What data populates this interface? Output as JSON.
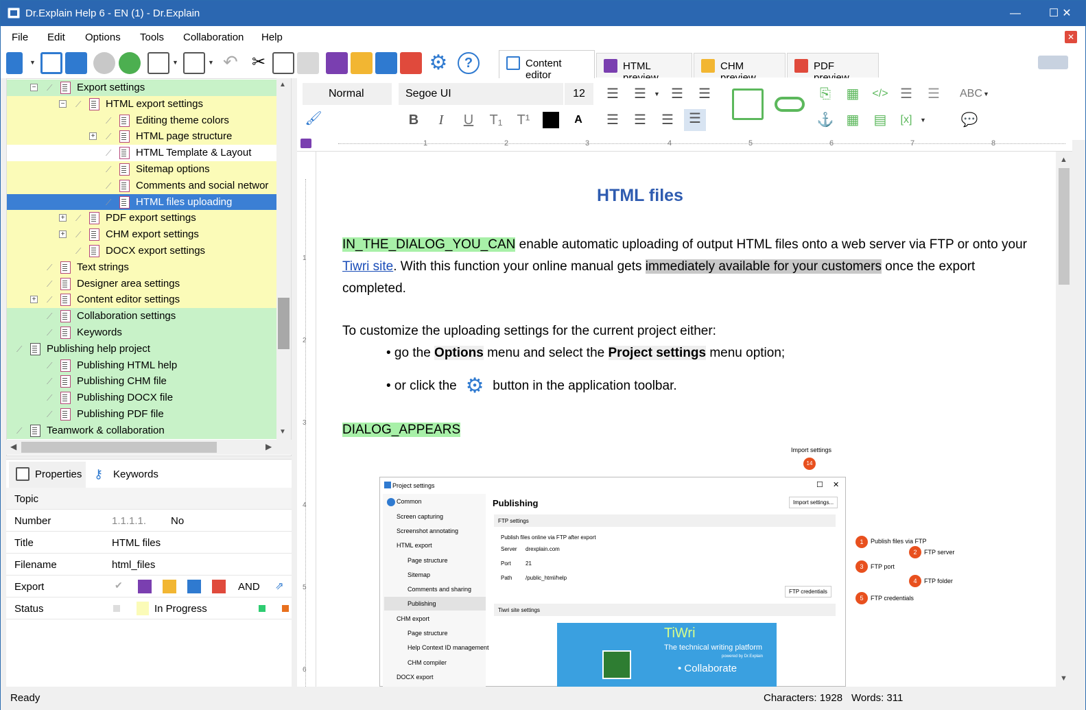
{
  "window": {
    "title": "Dr.Explain Help 6 - EN (1) - Dr.Explain",
    "minimize": "—",
    "maximize": "☐",
    "close": "✕"
  },
  "menu": [
    "File",
    "Edit",
    "Options",
    "Tools",
    "Collaboration",
    "Help"
  ],
  "tabs": {
    "content_editor": "Content editor",
    "html_preview": "HTML preview",
    "chm_preview": "CHM preview",
    "pdf_preview": "PDF preview"
  },
  "tree": [
    {
      "label": "Export settings",
      "level": 2,
      "color": "g",
      "expander": "−",
      "icon": "doc"
    },
    {
      "label": "HTML export settings",
      "level": 3,
      "color": "y",
      "expander": "−",
      "icon": "doc"
    },
    {
      "label": "Editing theme colors",
      "level": 4,
      "color": "y",
      "expander": "",
      "icon": "doc"
    },
    {
      "label": "HTML page structure",
      "level": 4,
      "color": "y",
      "expander": "+",
      "icon": "doc"
    },
    {
      "label": "HTML Template &  Layout",
      "level": 4,
      "color": "w",
      "expander": "",
      "icon": "doc"
    },
    {
      "label": "Sitemap options",
      "level": 4,
      "color": "y",
      "expander": "",
      "icon": "doc"
    },
    {
      "label": "Comments and social networ",
      "level": 4,
      "color": "y",
      "expander": "",
      "icon": "doc"
    },
    {
      "label": "HTML files uploading",
      "level": 4,
      "color": "sel",
      "expander": "",
      "icon": "doc"
    },
    {
      "label": "PDF export settings",
      "level": 3,
      "color": "y",
      "expander": "+",
      "icon": "doc"
    },
    {
      "label": "CHM export settings",
      "level": 3,
      "color": "y",
      "expander": "+",
      "icon": "doc"
    },
    {
      "label": "DOCX export settings",
      "level": 3,
      "color": "y",
      "expander": "",
      "icon": "doc"
    },
    {
      "label": "Text strings",
      "level": 2,
      "color": "y",
      "expander": "",
      "icon": "doc"
    },
    {
      "label": "Designer area settings",
      "level": 2,
      "color": "y",
      "expander": "",
      "icon": "doc"
    },
    {
      "label": "Content editor settings",
      "level": 2,
      "color": "y",
      "expander": "+",
      "icon": "doc"
    },
    {
      "label": "Collaboration settings",
      "level": 2,
      "color": "g",
      "expander": "",
      "icon": "doc"
    },
    {
      "label": "Keywords",
      "level": 2,
      "color": "g",
      "expander": "",
      "icon": "doc"
    },
    {
      "label": "Publishing help project",
      "level": 1,
      "color": "g",
      "expander": "",
      "icon": "doc"
    },
    {
      "label": "Publishing HTML help",
      "level": 2,
      "color": "g",
      "expander": "",
      "icon": "doc"
    },
    {
      "label": "Publishing CHM file",
      "level": 2,
      "color": "g",
      "expander": "",
      "icon": "doc"
    },
    {
      "label": "Publishing DOCX file",
      "level": 2,
      "color": "g",
      "expander": "",
      "icon": "doc"
    },
    {
      "label": "Publishing PDF file",
      "level": 2,
      "color": "g",
      "expander": "",
      "icon": "doc"
    },
    {
      "label": "Teamwork & collaboration",
      "level": 1,
      "color": "g",
      "expander": "",
      "icon": "doc"
    }
  ],
  "props_tabs": {
    "properties": "Properties",
    "keywords": "Keywords"
  },
  "props": {
    "topic": "Topic",
    "number": {
      "key": "Number",
      "value": "1.1.1.1.",
      "extra": "No"
    },
    "title": {
      "key": "Title",
      "value": "HTML files"
    },
    "filename": {
      "key": "Filename",
      "value": "html_files"
    },
    "export": {
      "key": "Export",
      "and": "AND"
    },
    "status": {
      "key": "Status",
      "value": "In Progress"
    }
  },
  "format": {
    "style": "Normal",
    "font": "Segoe UI",
    "size": "12"
  },
  "ruler_marks": [
    "1",
    "2",
    "3",
    "4",
    "5",
    "6",
    "7",
    "8"
  ],
  "vruler_marks": [
    "1",
    "2",
    "3",
    "4",
    "5",
    "6"
  ],
  "doc": {
    "title": "HTML files",
    "var1": "IN_THE_DIALOG_YOU_CAN",
    "p1a": " enable automatic uploading of output HTML files onto a web server via FTP or onto your",
    "link": "Tiwri site",
    "p1b": ". With this function your online manual gets ",
    "highlight": "immediately available for your customers",
    "p1c": " once the export",
    "p1d": "completed.",
    "p2": "To customize the uploading settings for the current project either:",
    "b1a": "• go the ",
    "b1b": "Options",
    "b1c": " menu and select the ",
    "b1d": "Project settings",
    "b1e": " menu option;",
    "b2a": "• or click the ",
    "b2b": " button in the application toolbar.",
    "var2": "DIALOG_APPEARS"
  },
  "screenshot": {
    "window_title": "Project settings",
    "heading": "Publishing",
    "import_btn": "Import settings...",
    "import_label": "Import settings",
    "ftp_section": "FTP settings",
    "checkbox": "Publish files online via FTP after export",
    "server_lbl": "Server",
    "server_val": "drexplain.com",
    "port_lbl": "Port",
    "port_val": "21",
    "path_lbl": "Path",
    "path_val": "/public_html/help",
    "cred_btn": "FTP credentials",
    "tiwri_section": "Tiwri site settings",
    "tiwri_title": "TiWri",
    "tiwri_sub": "The technical writing platform",
    "tiwri_small": "powered by Dr.Explain",
    "tiwri_collab": "• Collaborate",
    "nav": [
      "Common",
      "Screen capturing",
      "Screenshot annotating",
      "HTML export",
      "Page structure",
      "Sitemap",
      "Comments and sharing",
      "Publishing",
      "CHM export",
      "Page structure",
      "Help Context ID management",
      "CHM compiler",
      "DOCX export"
    ],
    "callouts": [
      {
        "n": "1",
        "t": "Publish files via FTP"
      },
      {
        "n": "2",
        "t": "FTP server"
      },
      {
        "n": "3",
        "t": "FTP port"
      },
      {
        "n": "4",
        "t": "FTP folder"
      },
      {
        "n": "5",
        "t": "FTP credentials"
      }
    ],
    "callout14": "14"
  },
  "status": {
    "ready": "Ready",
    "chars": "Characters: 1928",
    "words": "Words: 311"
  },
  "colors": {
    "titlebar": "#2b67b1",
    "selection": "#3b7fd4",
    "yellow": "#fbfbb8",
    "green": "#c8f2c8",
    "heading": "#2e5bb0",
    "var_green": "#a8f0a8",
    "callout": "#e8501e"
  }
}
